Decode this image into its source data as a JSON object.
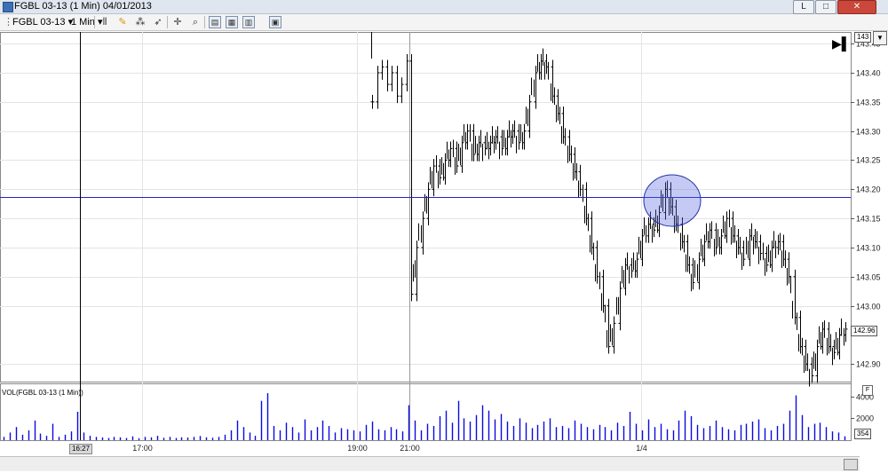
{
  "window": {
    "title": "FGBL 03-13 (1 Min)  04/01/2013",
    "buttons": {
      "min": "L",
      "restore": "□",
      "close": "✕"
    }
  },
  "toolbar": {
    "instrument": "FGBL 03-13",
    "interval": "1 Min",
    "icons": [
      "bars-icon",
      "pencil-icon",
      "magic-wand-icon",
      "crosshair-icon",
      "zoom-icon",
      "properties-icon",
      "data-box-icon",
      "grid-icon",
      "panel-icon"
    ]
  },
  "price_axis": {
    "ticks": [
      "143.45",
      "143.40",
      "143.35",
      "143.30",
      "143.25",
      "143.20",
      "143.15",
      "143.10",
      "143.05",
      "143.00",
      "142.90"
    ],
    "current_box": "142.96",
    "top_box": "143"
  },
  "time_axis": {
    "ticks": [
      "17:00",
      "19:00",
      "21:00",
      "1/4"
    ],
    "cursor_time": "16:27"
  },
  "volume_panel": {
    "label": "VOL(FGBL 03-13 (1 Min))",
    "ticks": [
      "4000",
      "2000"
    ],
    "current_box": "354",
    "f_button": "F"
  },
  "colors": {
    "price_line": "#000000",
    "volume": "#0a0ae0",
    "highlight": "#5566dd",
    "crosshair": "#2222cc"
  },
  "chart_data": {
    "type": "bar",
    "title": "",
    "xlabel": "",
    "ylabel": "",
    "ylim": [
      142.87,
      143.47
    ],
    "price_path": [
      143.35,
      143.4,
      143.41,
      143.38,
      143.4,
      143.36,
      143.38,
      143.42,
      143.02,
      143.1,
      143.15,
      143.2,
      143.24,
      143.22,
      143.25,
      143.27,
      143.24,
      143.28,
      143.3,
      143.26,
      143.28,
      143.27,
      143.28,
      143.29,
      143.27,
      143.29,
      143.3,
      143.28,
      143.3,
      143.35,
      143.4,
      143.42,
      143.41,
      143.36,
      143.33,
      143.29,
      143.26,
      143.23,
      143.2,
      143.15,
      143.1,
      143.05,
      143.0,
      142.93,
      142.97,
      143.03,
      143.07,
      143.06,
      143.08,
      143.12,
      143.14,
      143.13,
      143.16,
      143.2,
      143.17,
      143.14,
      143.11,
      143.07,
      143.04,
      143.08,
      143.11,
      143.13,
      143.1,
      143.12,
      143.15,
      143.12,
      143.1,
      143.08,
      143.12,
      143.11,
      143.09,
      143.07,
      143.1,
      143.11,
      143.08,
      143.05,
      142.98,
      142.93,
      142.9,
      142.88,
      142.93,
      142.96,
      142.93,
      142.92,
      142.95,
      142.96
    ],
    "volume_values": [
      300,
      700,
      1200,
      500,
      900,
      1800,
      600,
      400,
      1500,
      300,
      500,
      800,
      2600,
      700,
      400,
      300,
      250,
      200,
      300,
      260,
      200,
      350,
      180,
      300,
      260,
      400,
      220,
      300,
      200,
      260,
      240,
      300,
      380,
      260,
      220,
      300,
      500,
      900,
      1800,
      1200,
      700,
      400,
      3600,
      4300,
      1300,
      900,
      1600,
      1200,
      700,
      1900,
      900,
      1200,
      1800,
      1300,
      700,
      1100,
      1000,
      900,
      800,
      1400,
      1700,
      1000,
      900,
      1200,
      1000,
      800,
      3200,
      1800,
      900,
      1500,
      1300,
      2200,
      2700,
      1600,
      3600,
      2000,
      1700,
      2300,
      3200,
      2700,
      1900,
      2400,
      1700,
      1300,
      2000,
      1600,
      1100,
      1400,
      1700,
      2000,
      1200,
      1300,
      1100,
      1800,
      1500,
      1200,
      1000,
      1400,
      1200,
      900,
      1600,
      1300,
      2600,
      1500,
      900,
      1900,
      1200,
      1500,
      1000,
      900,
      1800,
      2700,
      2200,
      1400,
      1100,
      1300,
      1800,
      1200,
      1000,
      900,
      1400,
      1500,
      1700,
      1900,
      1100,
      900,
      1300,
      1500,
      2700,
      4100,
      2300,
      1200,
      1500,
      1600,
      1200,
      800,
      700,
      354
    ]
  }
}
